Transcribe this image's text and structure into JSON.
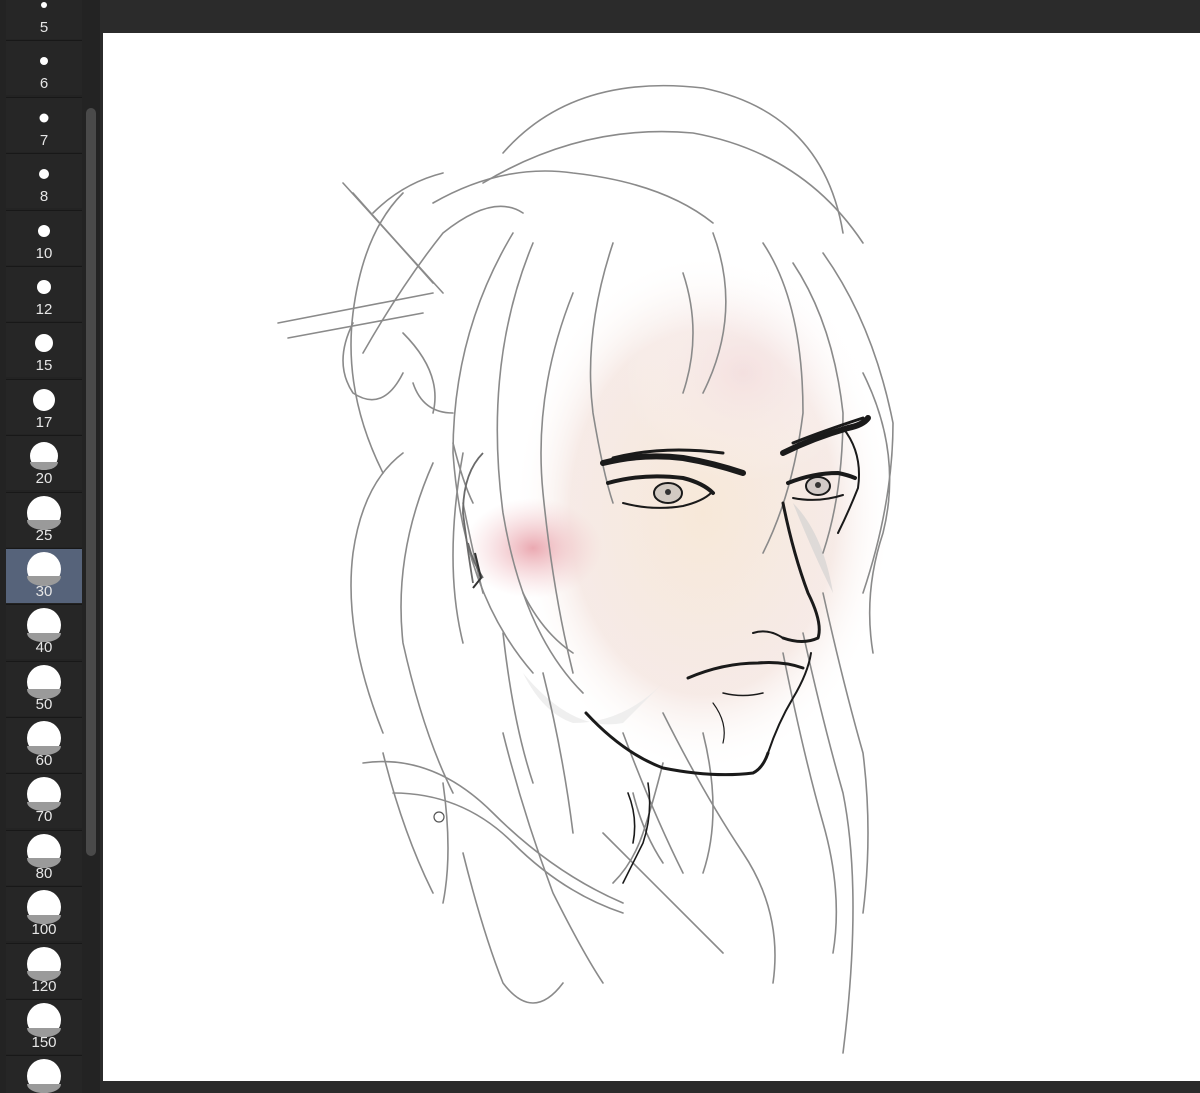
{
  "brush_sizes": [
    {
      "label": "5",
      "dot": 6,
      "large": false
    },
    {
      "label": "6",
      "dot": 8,
      "large": false
    },
    {
      "label": "7",
      "dot": 9,
      "large": false
    },
    {
      "label": "8",
      "dot": 10,
      "large": false
    },
    {
      "label": "10",
      "dot": 12,
      "large": false
    },
    {
      "label": "12",
      "dot": 14,
      "large": false
    },
    {
      "label": "15",
      "dot": 18,
      "large": false
    },
    {
      "label": "17",
      "dot": 22,
      "large": false
    },
    {
      "label": "20",
      "dot": 28,
      "large": true
    },
    {
      "label": "25",
      "dot": 34,
      "large": true
    },
    {
      "label": "30",
      "dot": 34,
      "large": true
    },
    {
      "label": "40",
      "dot": 34,
      "large": true
    },
    {
      "label": "50",
      "dot": 34,
      "large": true
    },
    {
      "label": "60",
      "dot": 34,
      "large": true
    },
    {
      "label": "70",
      "dot": 34,
      "large": true
    },
    {
      "label": "80",
      "dot": 34,
      "large": true
    },
    {
      "label": "100",
      "dot": 34,
      "large": true
    },
    {
      "label": "120",
      "dot": 34,
      "large": true
    },
    {
      "label": "150",
      "dot": 34,
      "large": true
    },
    {
      "label": "",
      "dot": 34,
      "large": true
    }
  ],
  "selected_brush": "30",
  "colors": {
    "panel_bg": "#232323",
    "selected_bg": "#56637a",
    "canvas_bg": "#ffffff",
    "sketch_line": "#8a8a8a",
    "ink_line": "#1a1a1a",
    "blush": "#e8a0a8"
  }
}
